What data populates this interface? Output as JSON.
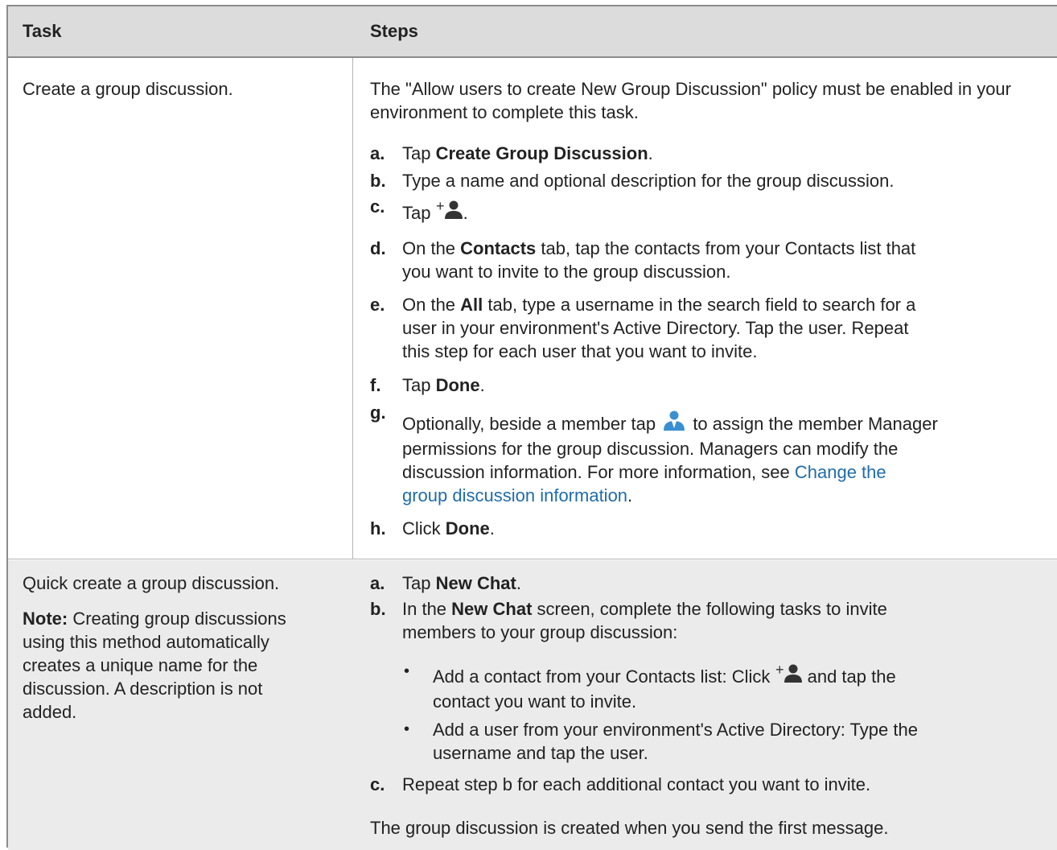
{
  "header": {
    "task": "Task",
    "steps": "Steps"
  },
  "row1": {
    "task": "Create a group discussion.",
    "intro": "The \"Allow users to create New Group Discussion\" policy must be enabled in your environment to complete this task.",
    "steps": {
      "a": {
        "label": "a.",
        "pre": "Tap ",
        "bold": "Create Group Discussion",
        "post": "."
      },
      "b": {
        "label": "b.",
        "text": "Type a name and optional description for the group discussion."
      },
      "c": {
        "label": "c.",
        "pre": "Tap ",
        "post": "."
      },
      "d": {
        "label": "d.",
        "pre": "On the ",
        "bold": "Contacts",
        "post1": " tab, tap the contacts from your Contacts list that",
        "post2": "you want to invite to the group discussion."
      },
      "e": {
        "label": "e.",
        "pre": "On the ",
        "bold": "All",
        "line1": " tab, type a username in the search field to search for a",
        "line2": "user in your environment's Active Directory. Tap the user. Repeat",
        "line3": "this step for each user that you want to invite."
      },
      "f": {
        "label": "f.",
        "pre": "Tap ",
        "bold": "Done",
        "post": "."
      },
      "g": {
        "label": "g.",
        "pre": "Optionally, beside a member tap ",
        "post": " to assign the member Manager",
        "line2": "permissions for the group discussion. Managers can modify the",
        "line3a": "discussion information. For more information, see ",
        "link1": "Change the",
        "link2": "group discussion information",
        "line4post": "."
      },
      "h": {
        "label": "h.",
        "pre": "Click ",
        "bold": "Done",
        "post": "."
      }
    }
  },
  "row2": {
    "task": "Quick create a group discussion.",
    "note_label": "Note:",
    "note_line1": " Creating group discussions",
    "note_line2": "using this method automatically",
    "note_line3": "creates a unique name for the",
    "note_line4": "discussion. A description is not",
    "note_line5": "added.",
    "steps": {
      "a": {
        "label": "a.",
        "pre": "Tap ",
        "bold": "New Chat",
        "post": "."
      },
      "b": {
        "label": "b.",
        "pre": "In the ",
        "bold": "New Chat",
        "post": " screen, complete the following tasks to invite",
        "line2": "members to your group discussion:"
      },
      "bullet1": {
        "pre": "Add a contact from your Contacts list: Click ",
        "post": " and tap the",
        "line2": "contact you want to invite."
      },
      "bullet2": {
        "line1": "Add a user from your environment's Active Directory: Type the",
        "line2": "username and tap the user."
      },
      "c": {
        "label": "c.",
        "text": "Repeat step b for each additional contact you want to invite."
      }
    },
    "footer": "The group discussion is created when you send the first message."
  },
  "colors": {
    "header_bg": "#dcdcdc",
    "row2_bg": "#ebebeb",
    "link": "#1f6cab",
    "icon_blue": "#3a8fd1",
    "icon_dark": "#333333"
  },
  "icons": {
    "add_contact": "add-contact-icon",
    "manager": "manager-icon"
  }
}
